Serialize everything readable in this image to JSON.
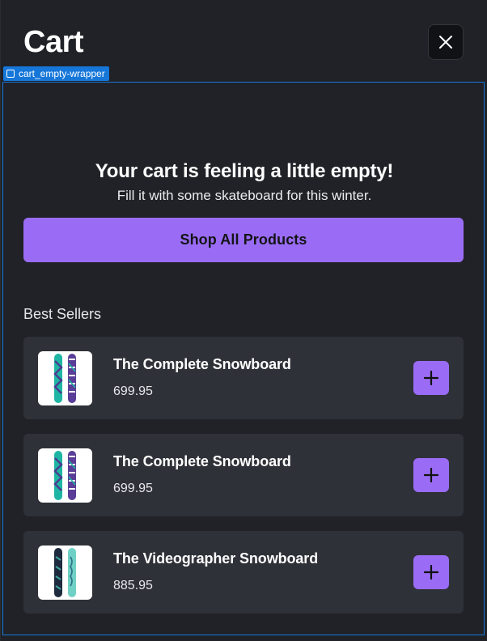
{
  "drawer": {
    "title": "Cart",
    "close_icon": "close-icon"
  },
  "debug_tag": {
    "label": "cart_empty-wrapper"
  },
  "empty_state": {
    "title": "Your cart is feeling a little empty!",
    "subtitle": "Fill it with some skateboard for this winter.",
    "cta_label": "Shop All Products"
  },
  "best_sellers": {
    "heading": "Best Sellers",
    "items": [
      {
        "name": "The Complete Snowboard",
        "price": "699.95",
        "thumb": "teal-purple-snowboard"
      },
      {
        "name": "The Complete Snowboard",
        "price": "699.95",
        "thumb": "teal-purple-snowboard"
      },
      {
        "name": "The Videographer Snowboard",
        "price": "885.95",
        "thumb": "navy-mint-snowboard"
      }
    ]
  },
  "colors": {
    "accent": "#9a6cf5",
    "panel": "#212227",
    "card": "#2f3138",
    "debug_outline": "#1677d9"
  }
}
